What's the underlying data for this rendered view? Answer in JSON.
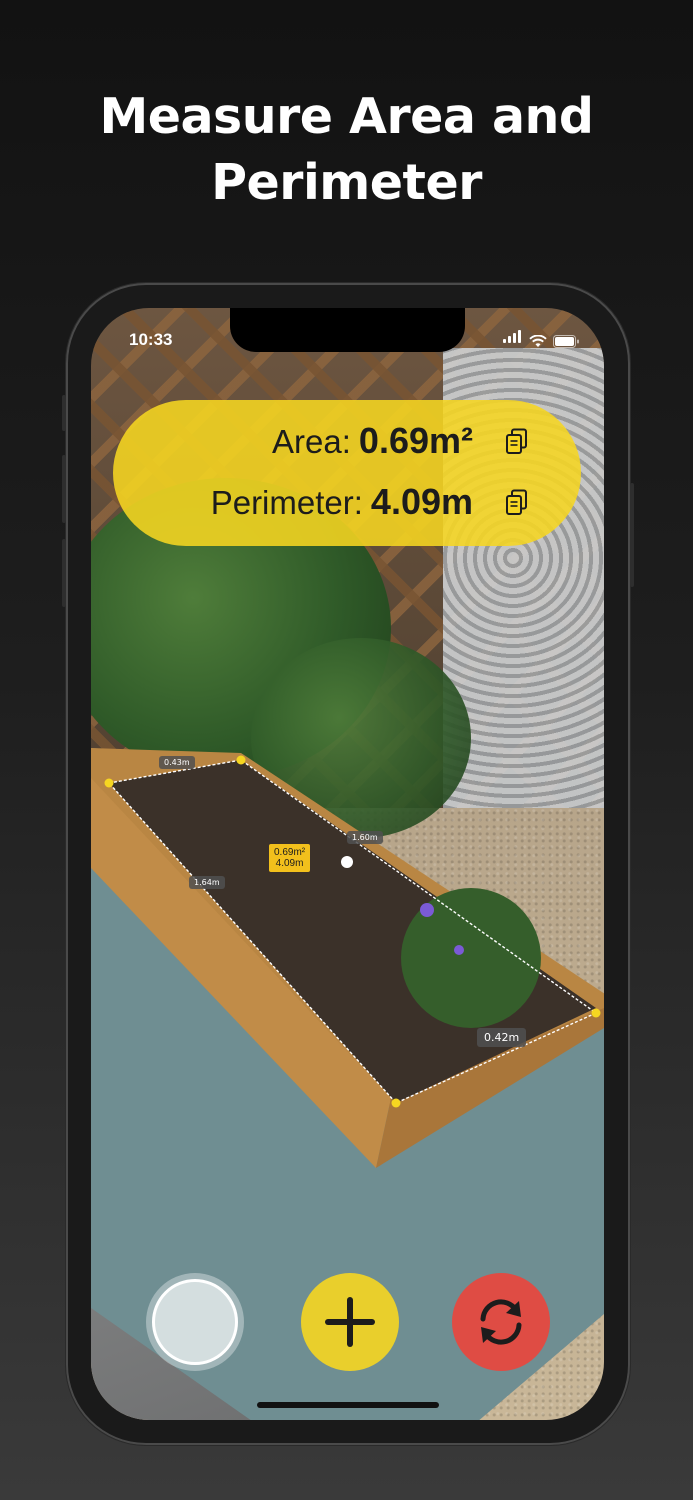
{
  "headline": {
    "line1": "Measure Area and",
    "line2": "Perimeter"
  },
  "status_bar": {
    "time": "10:33"
  },
  "measurement": {
    "area_label": "Area:",
    "area_value": "0.69m²",
    "perimeter_label": "Perimeter:",
    "perimeter_value": "4.09m"
  },
  "overlay": {
    "segments": [
      "0.43m",
      "1.60m",
      "1.64m",
      "0.42m"
    ],
    "center_area": "0.69m²",
    "center_perimeter": "4.09m"
  },
  "controls": {
    "capture_icon": "shutter-icon",
    "add_icon": "plus-icon",
    "reset_icon": "refresh-icon"
  },
  "colors": {
    "accent_yellow": "#f6d621",
    "reset_red": "#e8473e"
  }
}
